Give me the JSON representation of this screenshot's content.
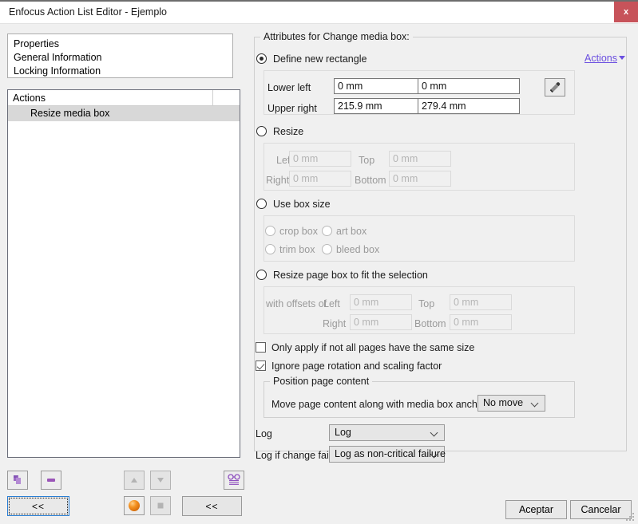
{
  "window": {
    "title": "Enfocus Action List Editor - Ejemplo",
    "close_label": "x"
  },
  "left_panel": {
    "properties": [
      {
        "label": "Properties"
      },
      {
        "label": "General Information"
      },
      {
        "label": "Locking Information"
      }
    ],
    "actions_header": "Actions",
    "actions": [
      {
        "label": "Resize media box",
        "selected": true
      }
    ],
    "toolbar": {
      "add_icon": "add-action-icon",
      "remove_icon": "remove-action-icon",
      "move_up_icon": "arrow-up-icon",
      "move_down_icon": "arrow-down-icon",
      "preview_icon": "glasses-icon",
      "sphere_icon": "orange-sphere-icon",
      "square_icon": "gray-square-icon",
      "collapse_left_label": "<<",
      "collapse_right_label": "<<"
    }
  },
  "attributes": {
    "group_title": "Attributes for Change media box:",
    "actions_link": "Actions",
    "define_new_rectangle": {
      "label": "Define new rectangle",
      "selected": true,
      "lower_left_label": "Lower left",
      "lower_left_x": "0 mm",
      "lower_left_y": "0 mm",
      "upper_right_label": "Upper right",
      "upper_right_x": "215.9 mm",
      "upper_right_y": "279.4 mm",
      "picker_icon": "eyedropper-icon"
    },
    "resize": {
      "label": "Resize",
      "selected": false,
      "left_label": "Left",
      "left_value": "0 mm",
      "top_label": "Top",
      "top_value": "0 mm",
      "right_label": "Right",
      "right_value": "0 mm",
      "bottom_label": "Bottom",
      "bottom_value": "0 mm"
    },
    "use_box_size": {
      "label": "Use box size",
      "selected": false,
      "options": [
        {
          "label": "crop box",
          "selected": false
        },
        {
          "label": "art box",
          "selected": false
        },
        {
          "label": "trim box",
          "selected": false
        },
        {
          "label": "bleed box",
          "selected": false
        }
      ]
    },
    "resize_to_selection": {
      "label": "Resize page box to fit the selection",
      "selected": false,
      "offsets_label": "with offsets of",
      "left_label": "Left",
      "left_value": "0 mm",
      "top_label": "Top",
      "top_value": "0 mm",
      "right_label": "Right",
      "right_value": "0 mm",
      "bottom_label": "Bottom",
      "bottom_value": "0 mm"
    },
    "checkboxes": [
      {
        "label": "Only apply if not all pages have the same size",
        "checked": false
      },
      {
        "label": "Ignore page rotation and scaling factor",
        "checked": true
      }
    ],
    "position_page_content": {
      "group_title": "Position page content",
      "anchor_label": "Move page content along with media box anchor point:",
      "anchor_value": "No move"
    },
    "log": {
      "log_label": "Log",
      "log_value": "Log",
      "fail_label": "Log if change fails",
      "fail_value": "Log as non-critical failure"
    }
  },
  "footer": {
    "ok_label": "Aceptar",
    "cancel_label": "Cancelar"
  }
}
